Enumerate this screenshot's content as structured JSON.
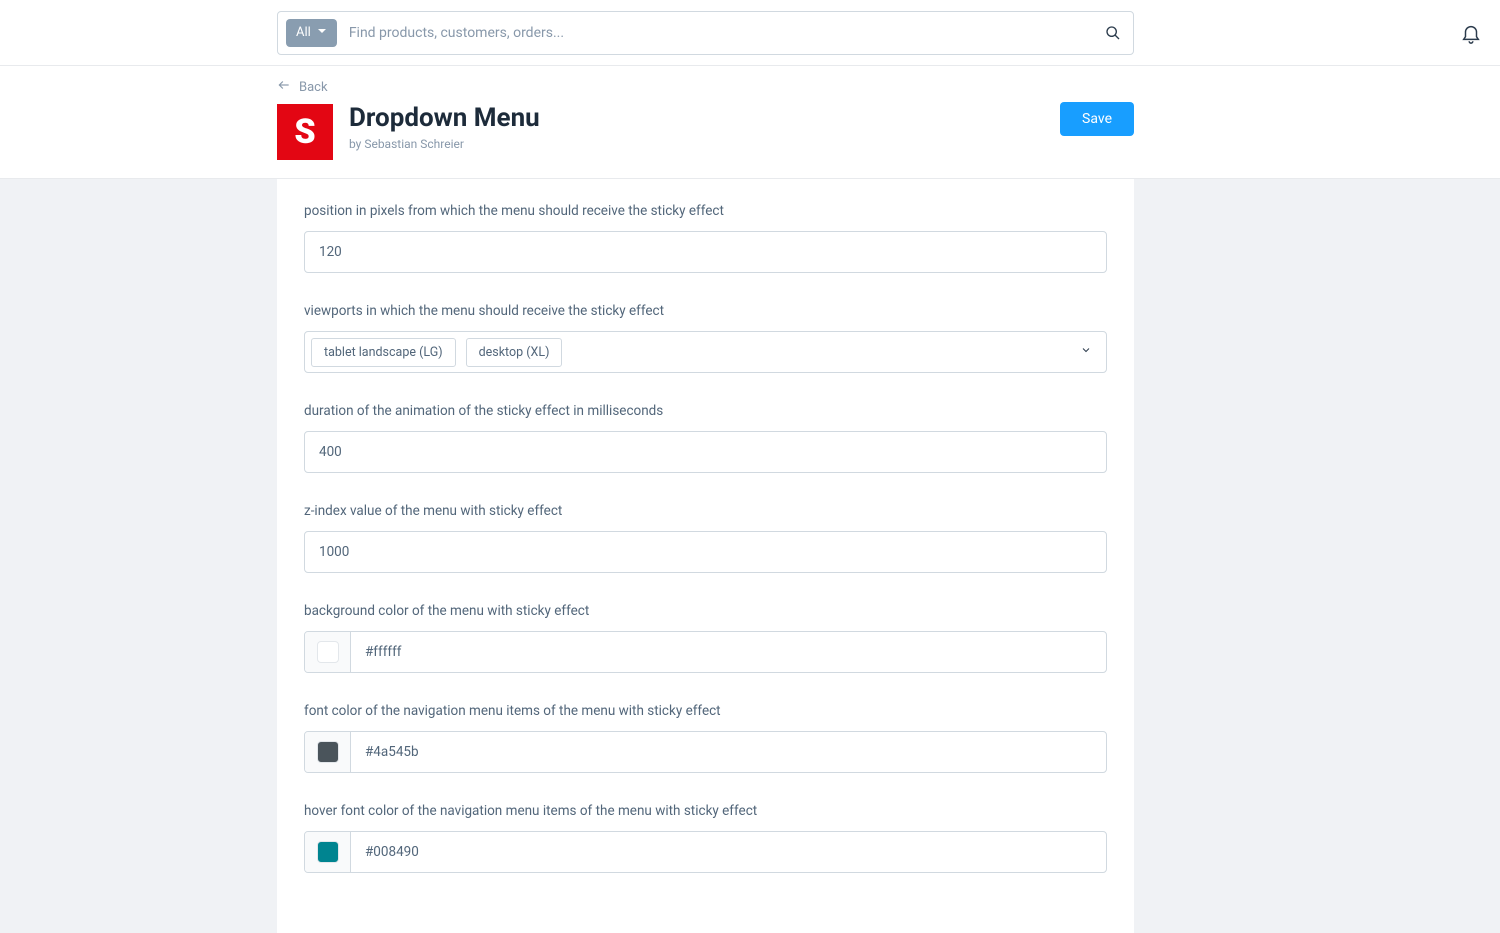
{
  "search": {
    "filter_label": "All",
    "placeholder": "Find products, customers, orders..."
  },
  "back_label": "Back",
  "extension_logo_letter": "S",
  "page_title": "Dropdown Menu",
  "page_subtitle": "by Sebastian Schreier",
  "save_label": "Save",
  "fields": {
    "sticky_position": {
      "label": "position in pixels from which the menu should receive the sticky effect",
      "value": "120"
    },
    "sticky_viewports": {
      "label": "viewports in which the menu should receive the sticky effect",
      "tags": [
        "tablet landscape (LG)",
        "desktop (XL)"
      ]
    },
    "sticky_duration": {
      "label": "duration of the animation of the sticky effect in milliseconds",
      "value": "400"
    },
    "sticky_zindex": {
      "label": "z-index value of the menu with sticky effect",
      "value": "1000"
    },
    "sticky_bg": {
      "label": "background color of the menu with sticky effect",
      "value": "#ffffff",
      "swatch": "#ffffff"
    },
    "sticky_font": {
      "label": "font color of the navigation menu items of the menu with sticky effect",
      "value": "#4a545b",
      "swatch": "#4a545b"
    },
    "sticky_hover_font": {
      "label": "hover font color of the navigation menu items of the menu with sticky effect",
      "value": "#008490",
      "swatch": "#008490"
    }
  }
}
